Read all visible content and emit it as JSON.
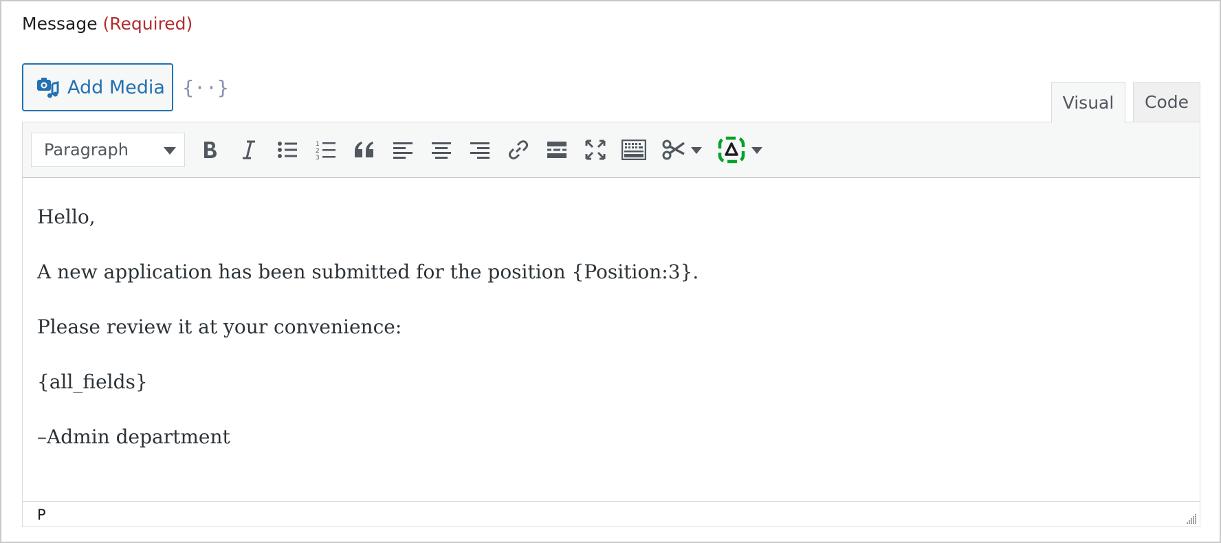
{
  "field": {
    "label": "Message",
    "required": "(Required)"
  },
  "add_media": {
    "label": "Add Media",
    "icon": "media-icon"
  },
  "merge_tags": {
    "label": "{··}",
    "icon": "merge-tags-icon"
  },
  "tabs": [
    {
      "label": "Visual",
      "active": true
    },
    {
      "label": "Code",
      "active": false
    }
  ],
  "toolbar": {
    "format": {
      "selected": "Paragraph"
    },
    "buttons": [
      "bold-icon",
      "italic-icon",
      "bulleted-list-icon",
      "numbered-list-icon",
      "blockquote-icon",
      "align-left-icon",
      "align-center-icon",
      "align-right-icon",
      "link-icon",
      "read-more-icon",
      "fullscreen-icon",
      "toolbar-toggle-icon",
      "scissors-icon",
      "ai-assistant-icon"
    ],
    "accent_color": "#00a32a"
  },
  "content": {
    "paragraphs": [
      "Hello,",
      "A new application has been submitted for the position {Position:3}.",
      "Please review it at your convenience:",
      "{all_fields}",
      "–Admin department"
    ]
  },
  "status_bar": {
    "path": "P"
  },
  "colors": {
    "required": "#b32d2e",
    "link": "#2271b1",
    "text": "#2c3338"
  }
}
